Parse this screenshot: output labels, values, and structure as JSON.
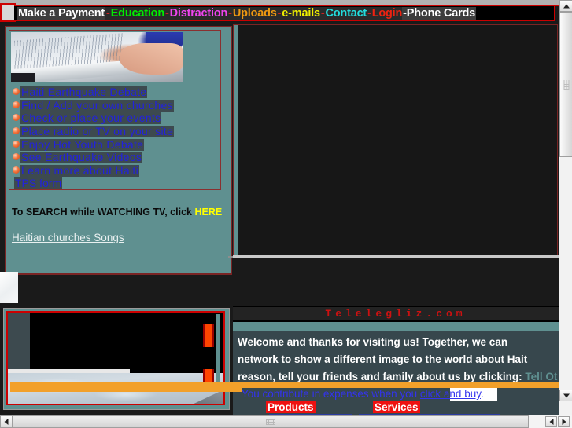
{
  "topnav": {
    "items": [
      {
        "label": "Make a Payment",
        "color": "#ffffff",
        "type": "plain"
      },
      {
        "label": "-",
        "color": "#cc2222",
        "type": "sep"
      },
      {
        "label": "Education",
        "color": "#00ee00",
        "type": "link"
      },
      {
        "label": "-",
        "color": "#cc2222",
        "type": "sep"
      },
      {
        "label": "Distraction",
        "color": "#ee44ee",
        "type": "link"
      },
      {
        "label": "-",
        "color": "#cc2222",
        "type": "sep"
      },
      {
        "label": "Uploads",
        "color": "#ee9911",
        "type": "link"
      },
      {
        "label": "-",
        "color": "#cc2222",
        "type": "sep"
      },
      {
        "label": "e-mails",
        "color": "#eeee00",
        "type": "link"
      },
      {
        "label": "-",
        "color": "#cc2222",
        "type": "sep"
      },
      {
        "label": "Contact",
        "color": "#22dddd",
        "type": "link"
      },
      {
        "label": "-",
        "color": "#cc2222",
        "type": "sep"
      },
      {
        "label": "Login",
        "color": "#ee2211",
        "type": "link"
      },
      {
        "label": "-Phone Cards",
        "color": "#ffffff",
        "type": "plain"
      }
    ]
  },
  "left_panel": {
    "photo_alt": "hands-on-open-book-photo",
    "links": [
      {
        "label": "Haiti   Earthquake   Debate"
      },
      {
        "label": "Find  /  Add  your own  churches"
      },
      {
        "label": "Check  or place your  events"
      },
      {
        "label": "Place radio or TV on your site"
      },
      {
        "label": "Enjoy   Hot   Youth   Debate"
      },
      {
        "label": "See   Earthquake   Videos"
      },
      {
        "label": "Learn   more  about Haiti"
      }
    ],
    "tps_form_label": "TPS form",
    "search_note_prefix": "To SEARCH while WATCHING TV, click ",
    "search_note_here": "HERE",
    "songs_link": "Haitian churches Songs"
  },
  "bottom_right": {
    "site_title": "Telelegliz.com",
    "welcome_lines": [
      "Welcome and  thanks  for  visiting   us! Together,  we  can",
      "network to  show  a  different  image  to  the  world about Hait",
      "reason, tell your friends and family about us by clicking: "
    ],
    "tell_others_link": "Tell Ot",
    "contribute_prefix": "You contribute in expenses when you ",
    "contribute_link": "click and buy",
    "contribute_suffix": ".",
    "products_tag": "Products",
    "services_tag": "Services"
  },
  "colors": {
    "panel_teal": "#5f9090",
    "frame_red": "#7a2424",
    "accent_red": "#cc0000",
    "link_blue": "#2222dd",
    "highlight_slate": "#3d4a4f",
    "orange_band": "#f2a02a",
    "bullet_orange": "#f4743c",
    "title_red": "#cc1111",
    "tag_red": "#ee1111"
  },
  "scrollbars": {
    "vertical_up": "scroll-up-arrow",
    "vertical_down": "scroll-down-arrow",
    "horizontal_left": "scroll-left-arrow",
    "horizontal_right": "scroll-right-arrow"
  }
}
